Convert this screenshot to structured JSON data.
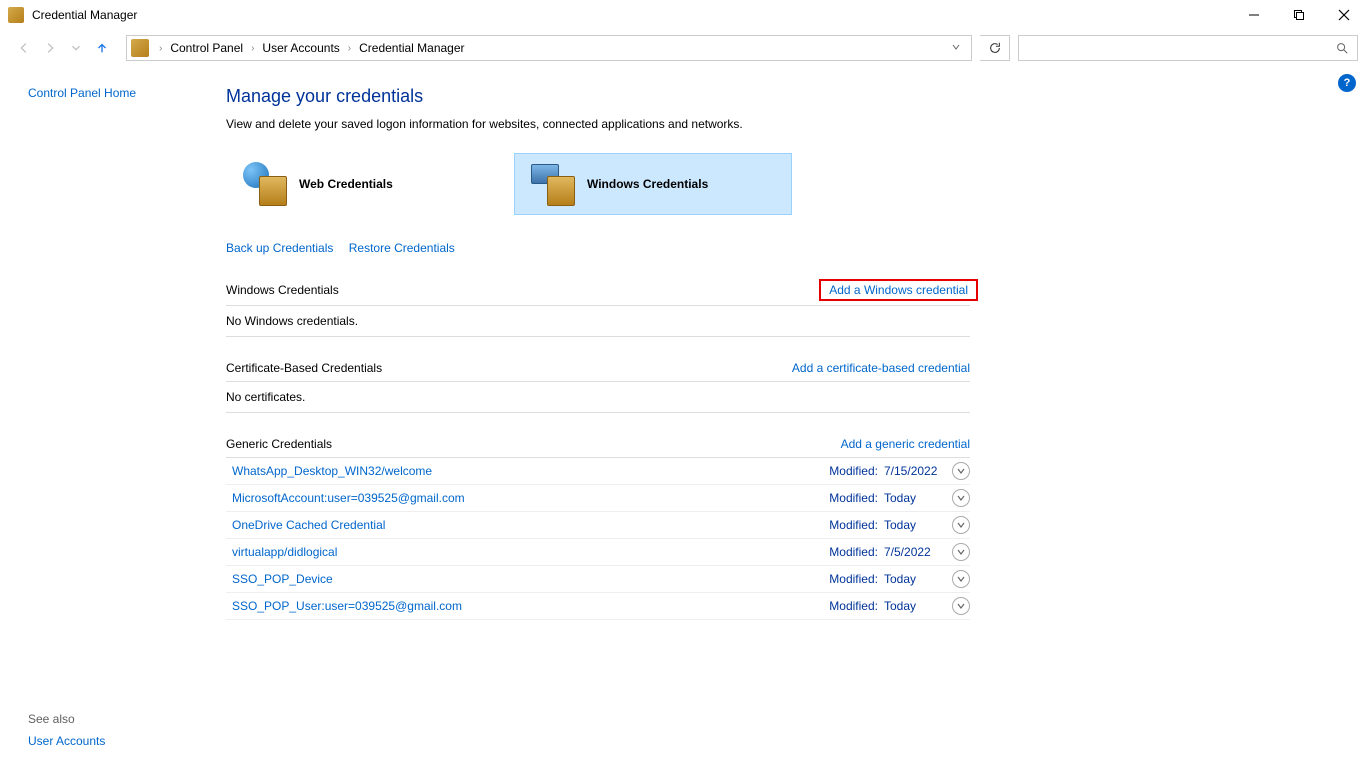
{
  "window": {
    "title": "Credential Manager"
  },
  "breadcrumb": {
    "items": [
      "Control Panel",
      "User Accounts",
      "Credential Manager"
    ]
  },
  "sidebar": {
    "home": "Control Panel Home",
    "see_also_label": "See also",
    "see_also_link": "User Accounts"
  },
  "page": {
    "title": "Manage your credentials",
    "description": "View and delete your saved logon information for websites, connected applications and networks."
  },
  "cards": {
    "web": "Web Credentials",
    "windows": "Windows Credentials"
  },
  "links": {
    "backup": "Back up Credentials",
    "restore": "Restore Credentials"
  },
  "sections": {
    "windows": {
      "title": "Windows Credentials",
      "add": "Add a Windows credential",
      "empty": "No Windows credentials."
    },
    "cert": {
      "title": "Certificate-Based Credentials",
      "add": "Add a certificate-based credential",
      "empty": "No certificates."
    },
    "generic": {
      "title": "Generic Credentials",
      "add": "Add a generic credential",
      "modified_label": "Modified:",
      "items": [
        {
          "name": "WhatsApp_Desktop_WIN32/welcome",
          "modified": "7/15/2022"
        },
        {
          "name": "MicrosoftAccount:user=039525@gmail.com",
          "modified": "Today"
        },
        {
          "name": "OneDrive Cached Credential",
          "modified": "Today"
        },
        {
          "name": "virtualapp/didlogical",
          "modified": "7/5/2022"
        },
        {
          "name": "SSO_POP_Device",
          "modified": "Today"
        },
        {
          "name": "SSO_POP_User:user=039525@gmail.com",
          "modified": "Today"
        }
      ]
    }
  }
}
